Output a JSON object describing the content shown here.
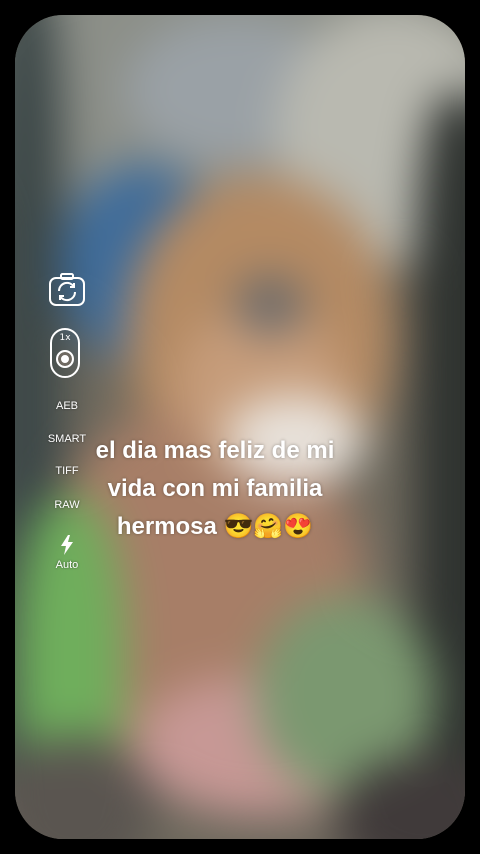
{
  "camera": {
    "zoom": "1x",
    "modes": [
      "AEB",
      "SMART",
      "TIFF",
      "RAW"
    ],
    "flash_mode": "Auto",
    "icons": {
      "flip": "flip-camera-icon",
      "shutter": "shutter-dot-icon",
      "flash": "flash-bolt-icon"
    }
  },
  "caption": {
    "line1": "el dia mas feliz de mi",
    "line2": "vida con mi familia",
    "line3": "hermosa 😎🤗😍"
  }
}
